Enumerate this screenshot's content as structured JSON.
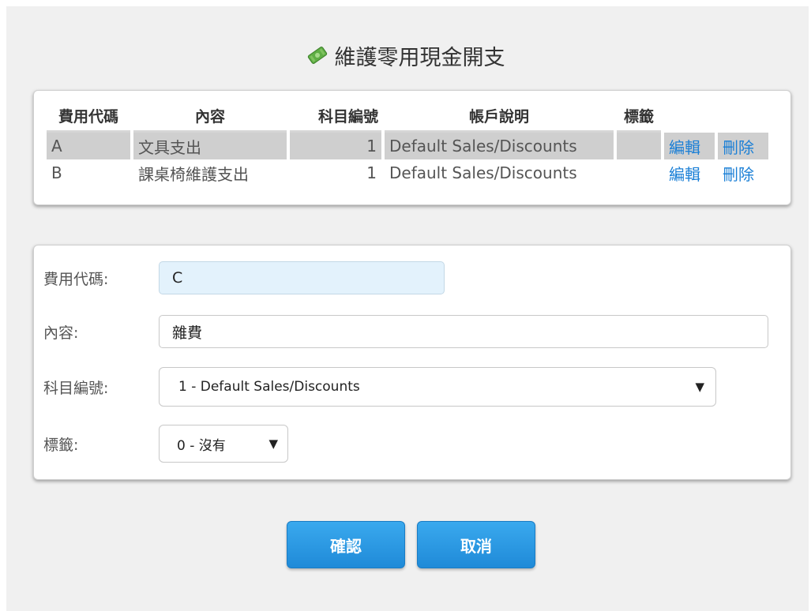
{
  "title": "維護零用現金開支",
  "title_icon": "cash-money-icon",
  "colors": {
    "page_bg": "#f0f0f0",
    "link": "#1a7fd6",
    "button": "#2a9be3",
    "focused_input_bg": "#e3f2fc",
    "selected_row": "#cfcfcf"
  },
  "table": {
    "headers": {
      "code": "費用代碼",
      "description": "內容",
      "account_no": "科目編號",
      "account_desc": "帳戶說明",
      "tag": "標籤"
    },
    "rows": [
      {
        "code": "A",
        "description": "文具支出",
        "account_no": "1",
        "account_desc": "Default Sales/Discounts",
        "tag": "",
        "edit": "編輯",
        "delete": "刪除"
      },
      {
        "code": "B",
        "description": "課桌椅維護支出",
        "account_no": "1",
        "account_desc": "Default Sales/Discounts",
        "tag": "",
        "edit": "編輯",
        "delete": "刪除"
      }
    ]
  },
  "form": {
    "code_label": "費用代碼:",
    "code_value": "C",
    "description_label": "內容:",
    "description_value": "雜費",
    "account_label": "科目編號:",
    "account_value": "1 - Default Sales/Discounts",
    "tag_label": "標籤:",
    "tag_value": "0 - 沒有"
  },
  "buttons": {
    "confirm": "確認",
    "cancel": "取消"
  }
}
